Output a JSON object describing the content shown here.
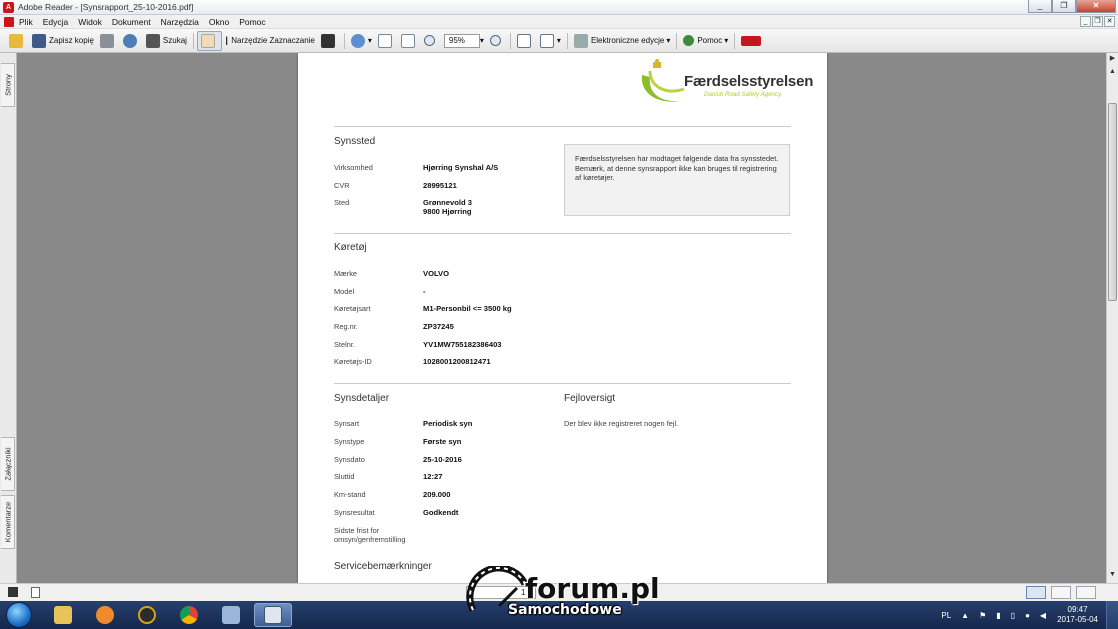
{
  "window": {
    "title": "Adobe Reader - [Synsrapport_25-10-2016.pdf]",
    "app_icon_letter": "A",
    "controls": [
      "_",
      "❐",
      "✕"
    ],
    "mdi_controls": [
      "_",
      "❐",
      "✕"
    ]
  },
  "menu": [
    "Plik",
    "Edycja",
    "Widok",
    "Dokument",
    "Narzędzia",
    "Okno",
    "Pomoc"
  ],
  "toolbar": {
    "save_copy": "Zapisz kopię",
    "search": "Szukaj",
    "select_tool": "Narzędzie Zaznaczanie",
    "zoom": "95%",
    "e_editions": "Elektroniczne edycje",
    "help": "Pomoc"
  },
  "left_tabs": {
    "pages": "Strony",
    "attachments": "Załączniki",
    "comments": "Komentarze"
  },
  "document": {
    "logo_brand": "Færdselsstyrelsen",
    "logo_tagline": "Danish Road Safety Agency",
    "synssted": {
      "title": "Synssted",
      "rows": [
        {
          "label": "Virksomhed",
          "value": "Hjørring Synshal A/S"
        },
        {
          "label": "CVR",
          "value": "28995121"
        },
        {
          "label": "Sted",
          "value": "Grønnevold 3",
          "value2": "9800 Hjørring"
        }
      ],
      "info": "Færdselsstyrelsen har modtaget følgende data fra synsstedet. Bemærk, at denne synsrapport ikke kan bruges til registrering af køretøjer."
    },
    "koretoj": {
      "title": "Køretøj",
      "rows": [
        {
          "label": "Mærke",
          "value": "VOLVO"
        },
        {
          "label": "Model",
          "value": "-"
        },
        {
          "label": "Køretøjsart",
          "value": "M1-Personbil <= 3500 kg"
        },
        {
          "label": "Reg.nr.",
          "value": "ZP37245"
        },
        {
          "label": "Stelnr.",
          "value": "YV1MW755182386403"
        },
        {
          "label": "Køretøjs-ID",
          "value": "1028001200812471"
        }
      ]
    },
    "synsdetaljer": {
      "title": "Synsdetaljer",
      "rows": [
        {
          "label": "Synsart",
          "value": "Periodisk syn"
        },
        {
          "label": "Synstype",
          "value": "Første syn"
        },
        {
          "label": "Synsdato",
          "value": "25-10-2016"
        },
        {
          "label": "Sluttid",
          "value": "12:27"
        },
        {
          "label": "Km-stand",
          "value": "209.000"
        },
        {
          "label": "Synsresultat",
          "value": "Godkendt"
        },
        {
          "label": "Sidste frist for",
          "label2": "omsyn/genfremstilling",
          "value": ""
        }
      ]
    },
    "fejloversigt": {
      "title": "Fejloversigt",
      "text": "Der blev ikke registreret nogen fejl."
    },
    "service": {
      "title": "Servicebemærkninger"
    }
  },
  "status": {
    "page_number": "1"
  },
  "watermark": {
    "forum": "forum.pl",
    "sub": "Samochodowe"
  },
  "taskbar": {
    "lang": "PL",
    "time": "09:47",
    "date": "2017-05-04"
  },
  "colors": {
    "accent_green": "#8cbf26",
    "titlebar": "#e7ebf2",
    "taskbar": "#1d3563"
  }
}
